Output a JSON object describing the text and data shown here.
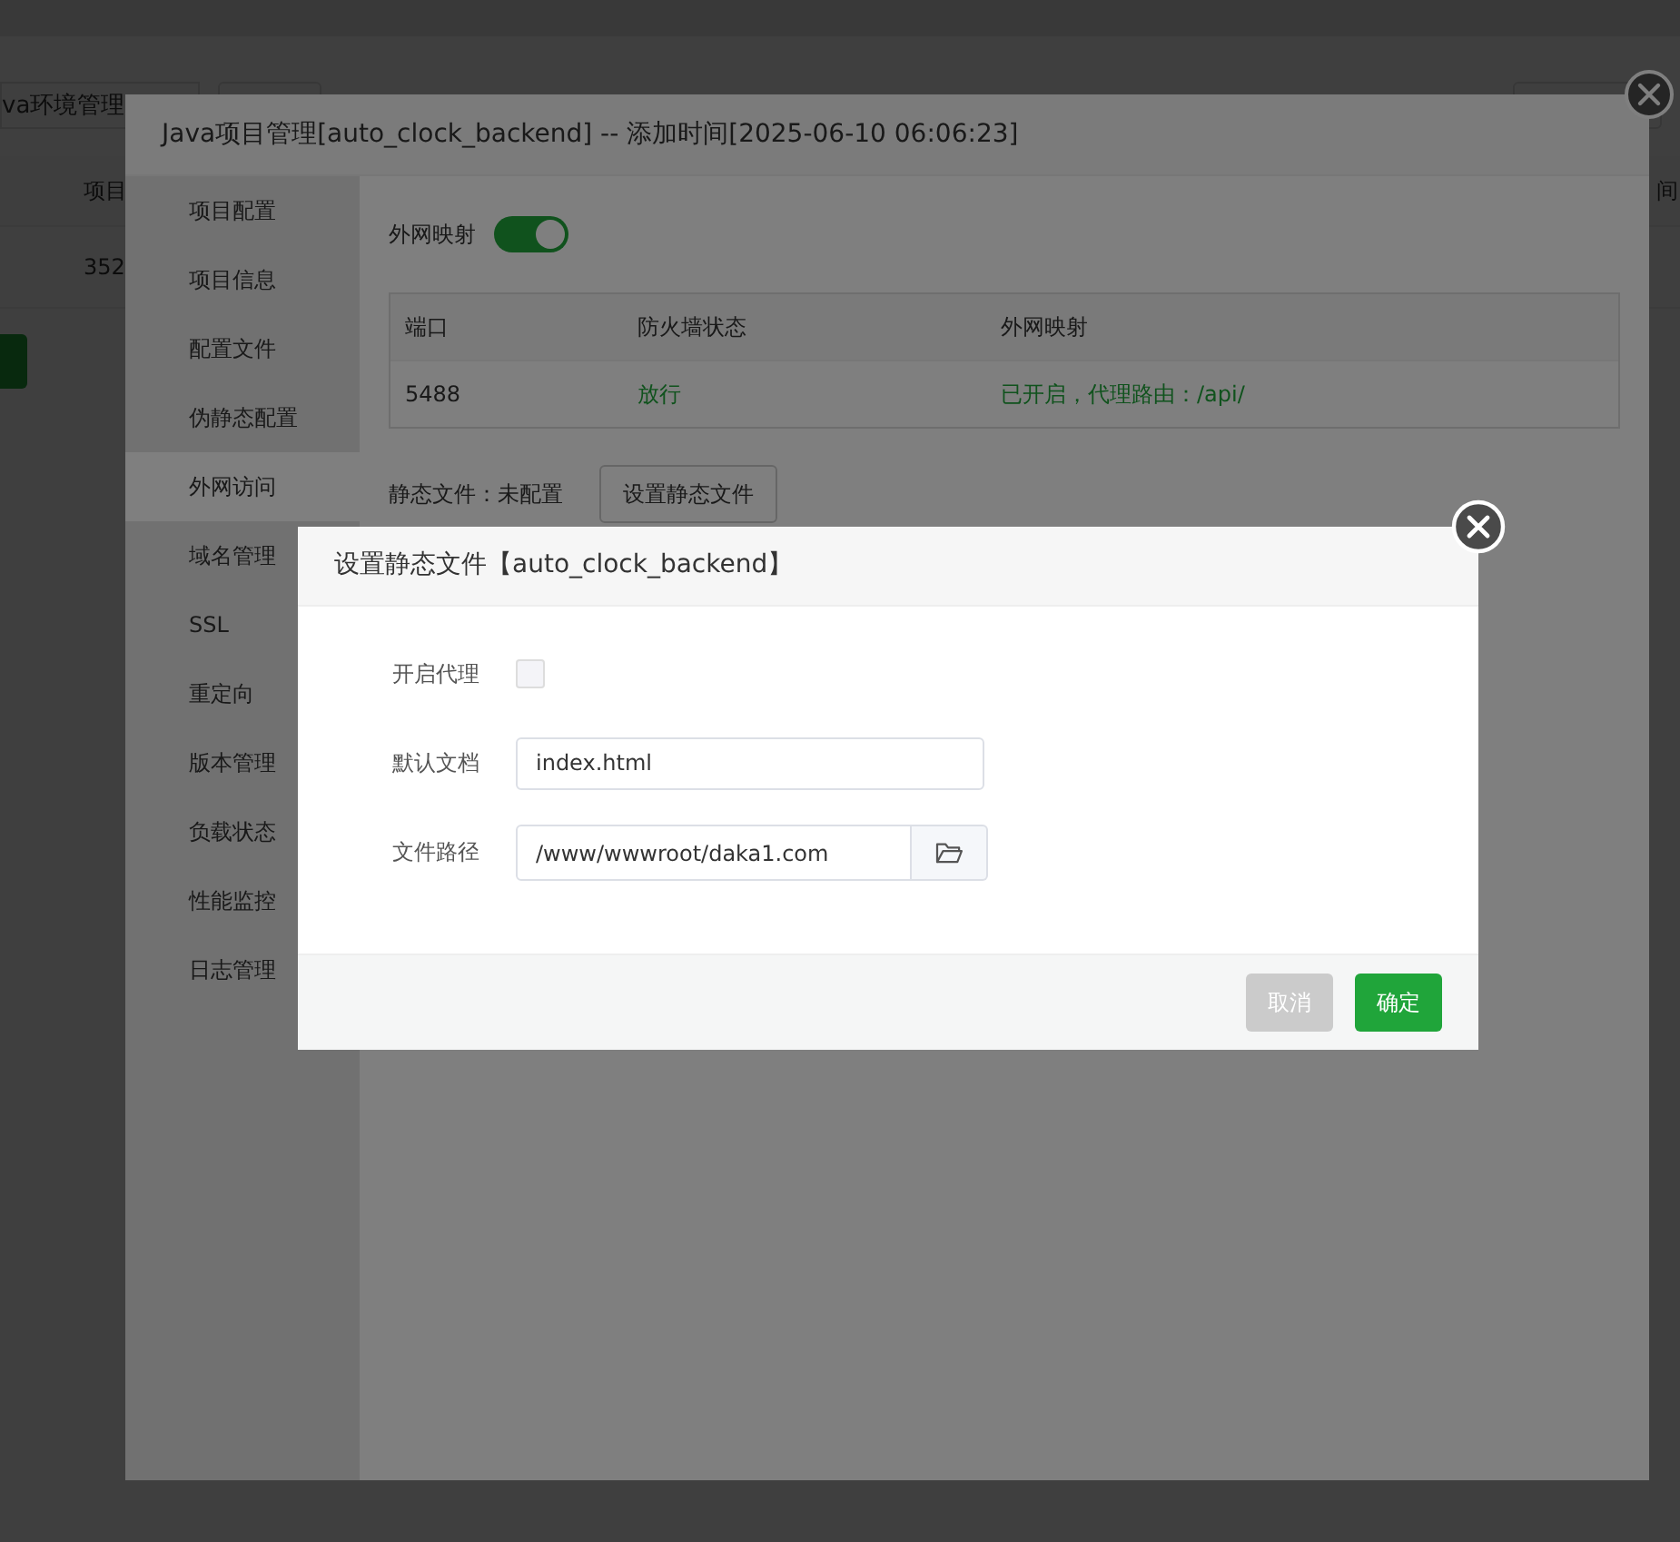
{
  "background_page": {
    "tab": "va环境管理",
    "columns": [
      "项目",
      "间"
    ],
    "cell": "352"
  },
  "project_window": {
    "title": "Java项目管理[auto_clock_backend] -- 添加时间[2025-06-10 06:06:23]",
    "sidebar": {
      "items": [
        {
          "label": "项目配置",
          "selected": false
        },
        {
          "label": "项目信息",
          "selected": false
        },
        {
          "label": "配置文件",
          "selected": false
        },
        {
          "label": "伪静态配置",
          "selected": false
        },
        {
          "label": "外网访问",
          "selected": true
        },
        {
          "label": "域名管理",
          "selected": false
        },
        {
          "label": "SSL",
          "selected": false
        },
        {
          "label": "重定向",
          "selected": false
        },
        {
          "label": "版本管理",
          "selected": false
        },
        {
          "label": "负载状态",
          "selected": false
        },
        {
          "label": "性能监控",
          "selected": false
        },
        {
          "label": "日志管理",
          "selected": false
        }
      ]
    },
    "mapping_toggle": {
      "label": "外网映射",
      "on": true
    },
    "table": {
      "columns": [
        "端口",
        "防火墙状态",
        "外网映射"
      ],
      "rows": [
        [
          {
            "text": "5488",
            "kind": "plain"
          },
          {
            "text": "放行",
            "kind": "ok"
          },
          {
            "text": "已开启，代理路由：/api/",
            "kind": "ok"
          }
        ]
      ]
    },
    "static_files": {
      "label": "静态文件：未配置",
      "button": "设置静态文件"
    }
  },
  "static_dialog": {
    "title": "设置静态文件【auto_clock_backend】",
    "fields": [
      {
        "kind": "checkbox",
        "label": "开启代理",
        "checked": false
      },
      {
        "kind": "text",
        "label": "默认文档",
        "value": "index.html"
      },
      {
        "kind": "path",
        "label": "文件路径",
        "value": "/www/wwwroot/daka1.com"
      }
    ],
    "buttons": [
      {
        "label": "取消",
        "kind": "secondary"
      },
      {
        "label": "确定",
        "kind": "primary"
      }
    ]
  }
}
